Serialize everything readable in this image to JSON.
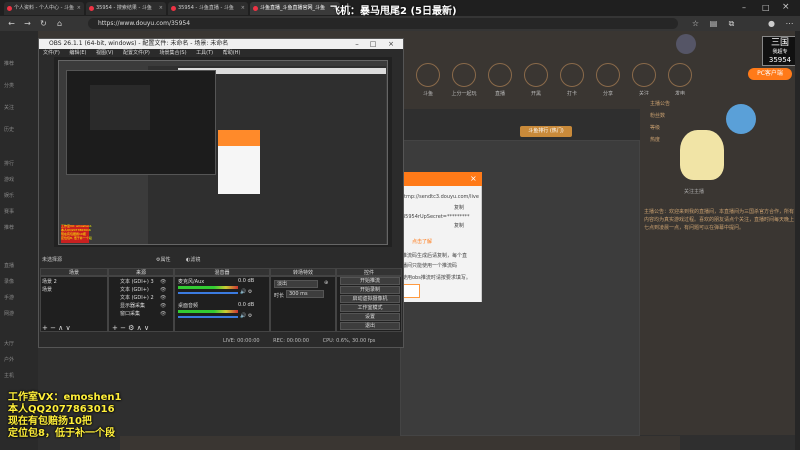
{
  "browser": {
    "tabs": [
      {
        "label": "个人资料 - 个人中心 - 斗鱼"
      },
      {
        "label": "35954 - 搜索结果 - 斗鱼"
      },
      {
        "label": "35954 - 斗鱼直播 - 斗鱼"
      },
      {
        "label": "斗鱼直播_斗鱼直播官网_斗鱼"
      }
    ],
    "new_tab": "+",
    "url": "https://www.douyu.com/35954",
    "overlay_text": "飞机：暴马甩尾2 (5日最新)"
  },
  "site": {
    "logo_line1": "三国",
    "logo_line2": "我超专",
    "logo_line3": "35954",
    "pc_button": "PC客户端",
    "nav_items": [
      "推荐",
      "分类",
      "关注",
      "历史",
      "排行",
      "游戏",
      "娱乐",
      "赛事",
      "推荐",
      "直播",
      "录像",
      "手游",
      "网游",
      "大厅",
      "户外",
      "主机",
      "科技",
      "文娱"
    ],
    "top_icons": [
      "斗鱼",
      "上分一起玩",
      "直播",
      "开黑",
      "打卡",
      "分享",
      "关注",
      "发电"
    ],
    "rank_badge": "斗鱼排行 (热门)",
    "follow_text": "关注主播",
    "right_text": "主播公告：欢迎来到我的直播间，本直播间为三国杀官方合作，所有内容均为真实游戏过程。喜欢的朋友请点个关注，直播时间每天晚上七点到凌晨一点，有问题可以在弹幕中提问。",
    "right_lines": [
      "主播公告",
      "粉丝数",
      "等级",
      "热度"
    ]
  },
  "popup": {
    "close": "×",
    "url_line": "rtmp://sendtc3.douyu.com/live",
    "copy1": "复制",
    "key_line": "35954rUpSecret=*********",
    "copy2": "复制",
    "hint": "点击了解",
    "note1": "推流码生成后请复制，每个直",
    "note2": "播间只能使用一个推流码",
    "note3": "使用obs推流时请按要求填写。",
    "input_value": ""
  },
  "obs": {
    "title": "OBS 26.1.1 (64-bit, windows) - 配置文件: 未命名 - 场景: 未命名",
    "menu": [
      "文件(F)",
      "编辑(E)",
      "视图(V)",
      "配置文件(P)",
      "场景集合(S)",
      "工具(T)",
      "帮助(H)"
    ],
    "no_source": "未选择源",
    "props_btn": "属性",
    "filters_btn": "滤镜",
    "docks": {
      "scenes": "场景",
      "sources": "来源",
      "mixer": "混音器",
      "transitions": "转场特效",
      "controls": "控件"
    },
    "scene_items": [
      "场景 2",
      "场景"
    ],
    "source_items": [
      "文本 (GDI+) 3",
      "文本 (GDI+)",
      "文本 (GDI+) 2",
      "显示器采集",
      "窗口采集"
    ],
    "mixer_items": [
      {
        "name": "麦克风/Aux",
        "db": "0.0 dB"
      },
      {
        "name": "桌面音频",
        "db": "0.0 dB"
      }
    ],
    "transition_value": "淡出",
    "duration_label": "时长",
    "duration_value": "300 ms",
    "controls": [
      "开始推流",
      "开始录制",
      "启动虚拟摄像机",
      "工作室模式",
      "设置",
      "退出"
    ],
    "status": {
      "live": "LIVE: 00:00:00",
      "rec": "REC: 00:00:00",
      "cpu": "CPU: 0.6%, 30.00 fps"
    },
    "nested_chat_lines": [
      "工作室VX: emoshen1",
      "本人QQ2077863016",
      "现在有包赔扬10把",
      "定位包8, 低于补一个段"
    ]
  },
  "promo": {
    "line1": "工作室VX：emoshen1",
    "line2": "本人QQ2077863016",
    "line3": "现在有包赔扬10把",
    "line4": "定位包8，低于补一个段"
  },
  "colors": {
    "accent": "#ff7a18",
    "promo_yellow": "#ffef3a"
  }
}
